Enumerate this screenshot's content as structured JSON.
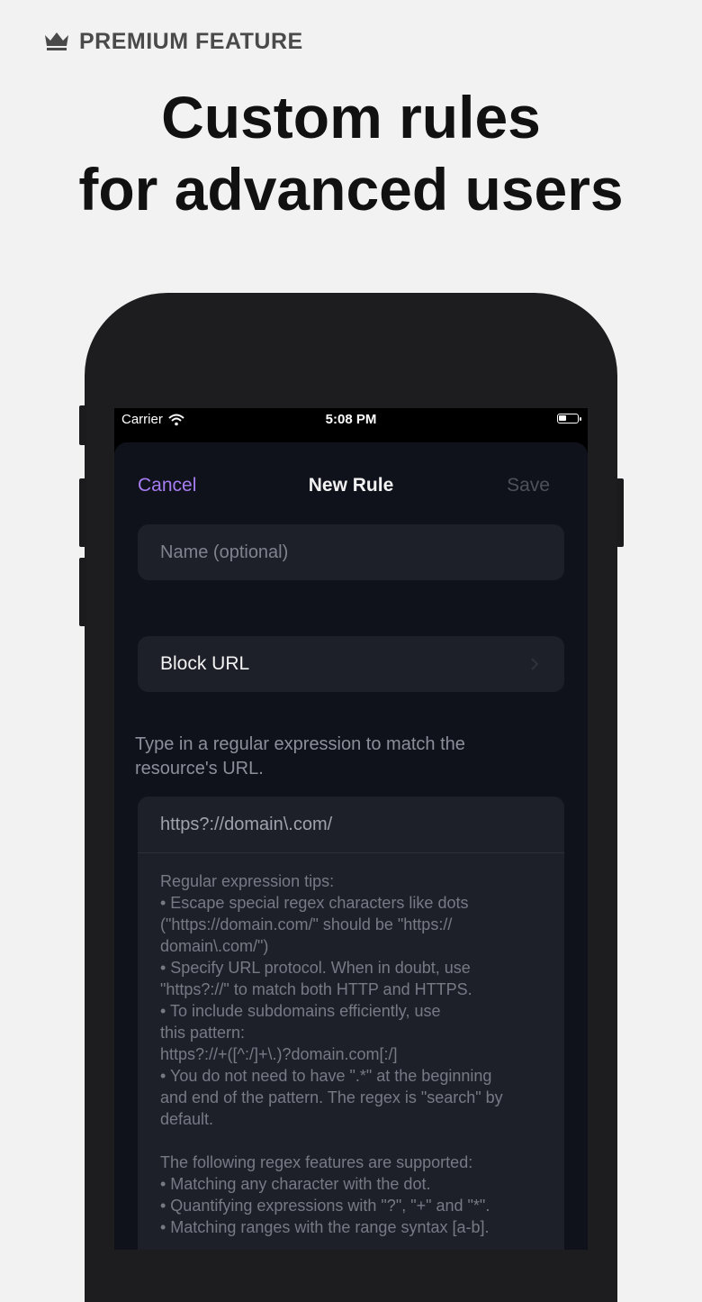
{
  "badge": {
    "icon": "crown-icon",
    "label": "PREMIUM FEATURE"
  },
  "headline": {
    "line1": "Custom rules",
    "line2": "for advanced users"
  },
  "status_bar": {
    "carrier": "Carrier",
    "time": "5:08 PM"
  },
  "nav": {
    "cancel": "Cancel",
    "title": "New Rule",
    "save": "Save"
  },
  "name_field": {
    "placeholder": "Name (optional)",
    "value": ""
  },
  "rule_type": {
    "label": "Block URL"
  },
  "hint": "Type in a regular expression to match the resource's URL.",
  "regex_field": {
    "value": "https?://domain\\.com/"
  },
  "tips": {
    "lines": [
      "Regular expression tips:",
      "• Escape special regex characters like dots",
      "(\"https://domain.com/\" should be \"https://",
      "domain\\.com/\")",
      "• Specify URL protocol. When in doubt, use",
      "\"https?://\" to match both HTTP and HTTPS.",
      "• To include subdomains efficiently, use",
      "this pattern:",
      "https?://+([^:/]+\\.)?domain.com[:/]",
      "• You do not need to have \".*\" at the beginning",
      "and end of the pattern. The regex is \"search\" by",
      "default."
    ],
    "lines2": [
      "The following regex features are supported:",
      "• Matching any character with the dot.",
      "• Quantifying expressions with \"?\", \"+\" and \"*\".",
      "• Matching ranges with the range syntax [a-b]."
    ]
  },
  "colors": {
    "background": "#f2f2f2",
    "accent": "#a67df0",
    "sheet": "#10121b",
    "field": "#1e2029"
  }
}
